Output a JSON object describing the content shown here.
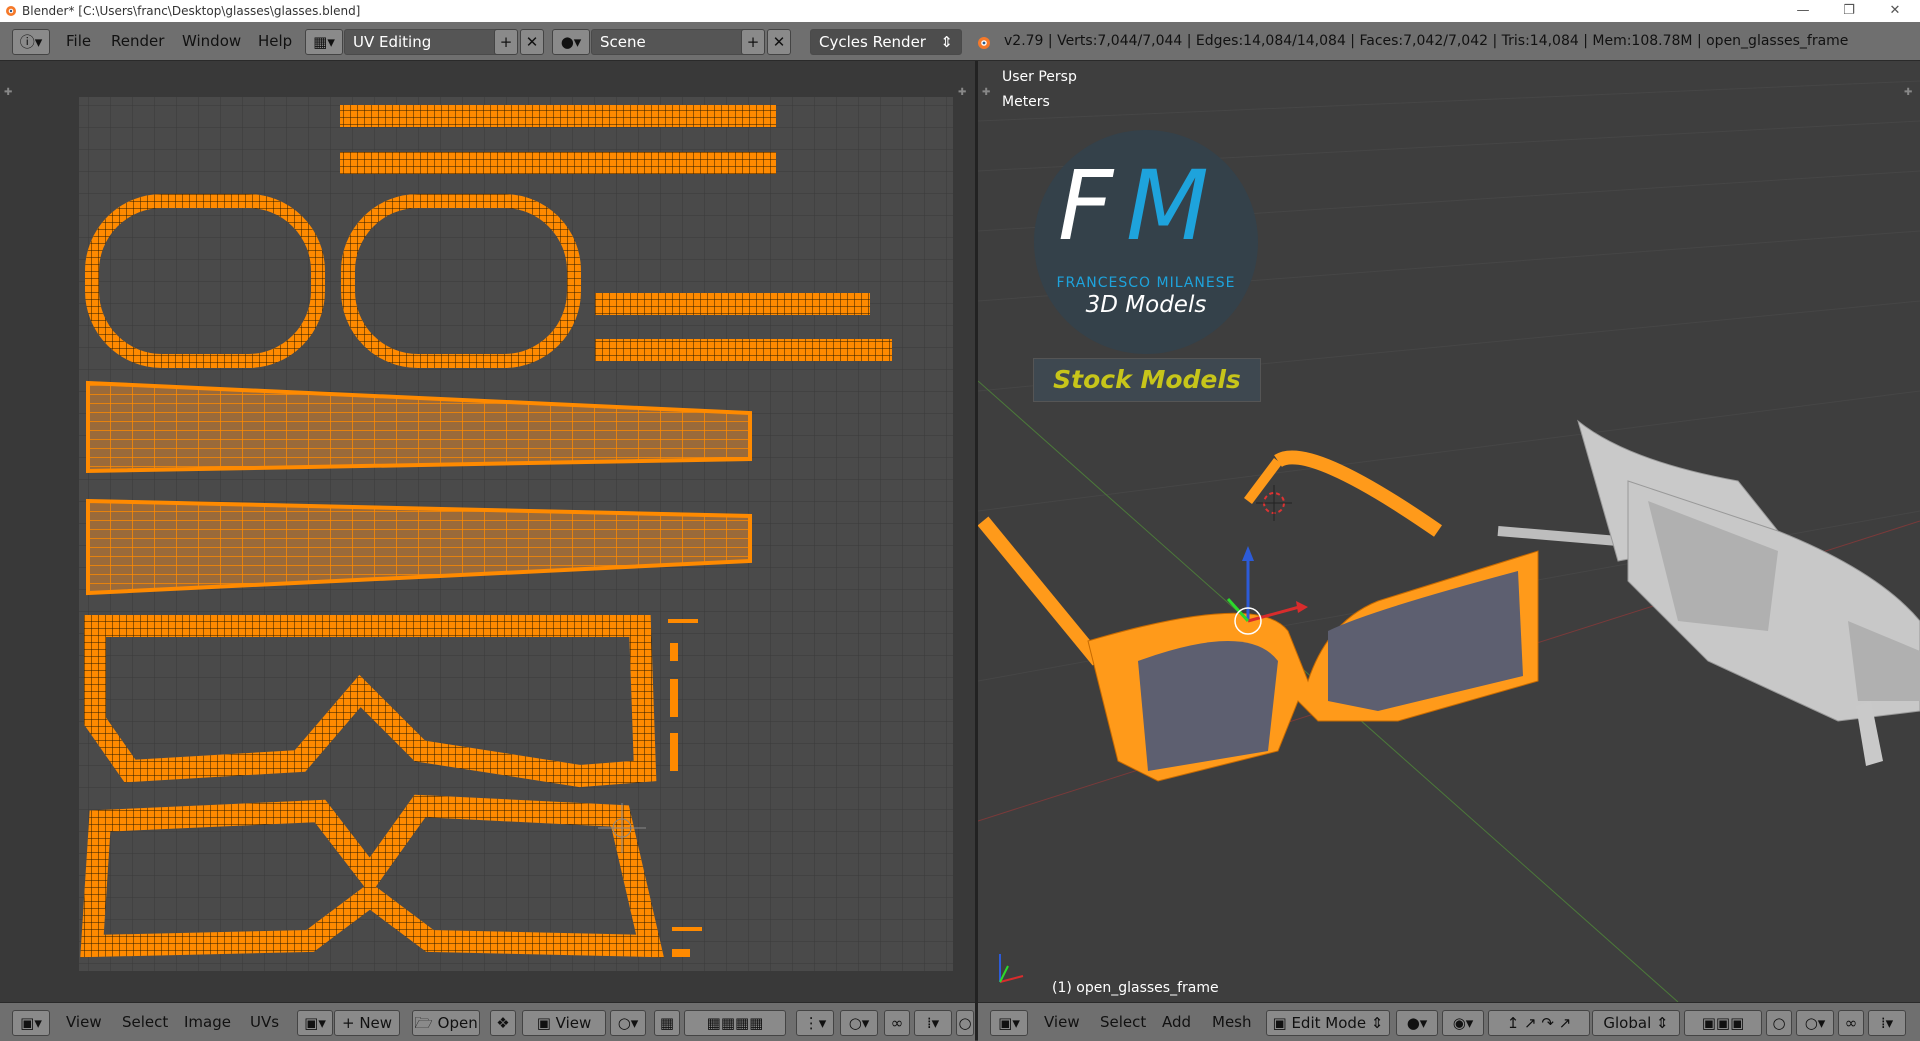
{
  "window": {
    "title": "Blender* [C:\\Users\\franc\\Desktop\\glasses\\glasses.blend]",
    "min_icon": "minimize-icon",
    "max_icon": "maximize-icon",
    "close_icon": "close-icon"
  },
  "topbar": {
    "menus": [
      "File",
      "Render",
      "Window",
      "Help"
    ],
    "screen_layout": "UV Editing",
    "scene": "Scene",
    "render_engine": "Cycles Render",
    "stats": "v2.79 | Verts:7,044/7,044 | Edges:14,084/14,084 | Faces:7,042/7,042 | Tris:14,084 | Mem:108.78M | open_glasses_frame"
  },
  "viewport": {
    "view_name": "User Persp",
    "units": "Meters",
    "object_label": "(1) open_glasses_frame"
  },
  "logo": {
    "letters_f": "F",
    "letters_m": "M",
    "author": "FRANCESCO MILANESE",
    "tagline": "3D Models",
    "stock": "Stock Models"
  },
  "uv_footer": {
    "menus": [
      "View",
      "Select",
      "Image",
      "UVs"
    ],
    "new_label": "New",
    "open_label": "Open",
    "view_label": "View"
  },
  "v3d_footer": {
    "menus": [
      "View",
      "Select",
      "Add",
      "Mesh"
    ],
    "mode": "Edit Mode",
    "orientation": "Global"
  },
  "colors": {
    "uv_orange": "#ff8a00",
    "frame_orange": "#ff9a1a",
    "logo_blue": "#1ea3dc",
    "stock_yellow": "#c7c51a"
  }
}
